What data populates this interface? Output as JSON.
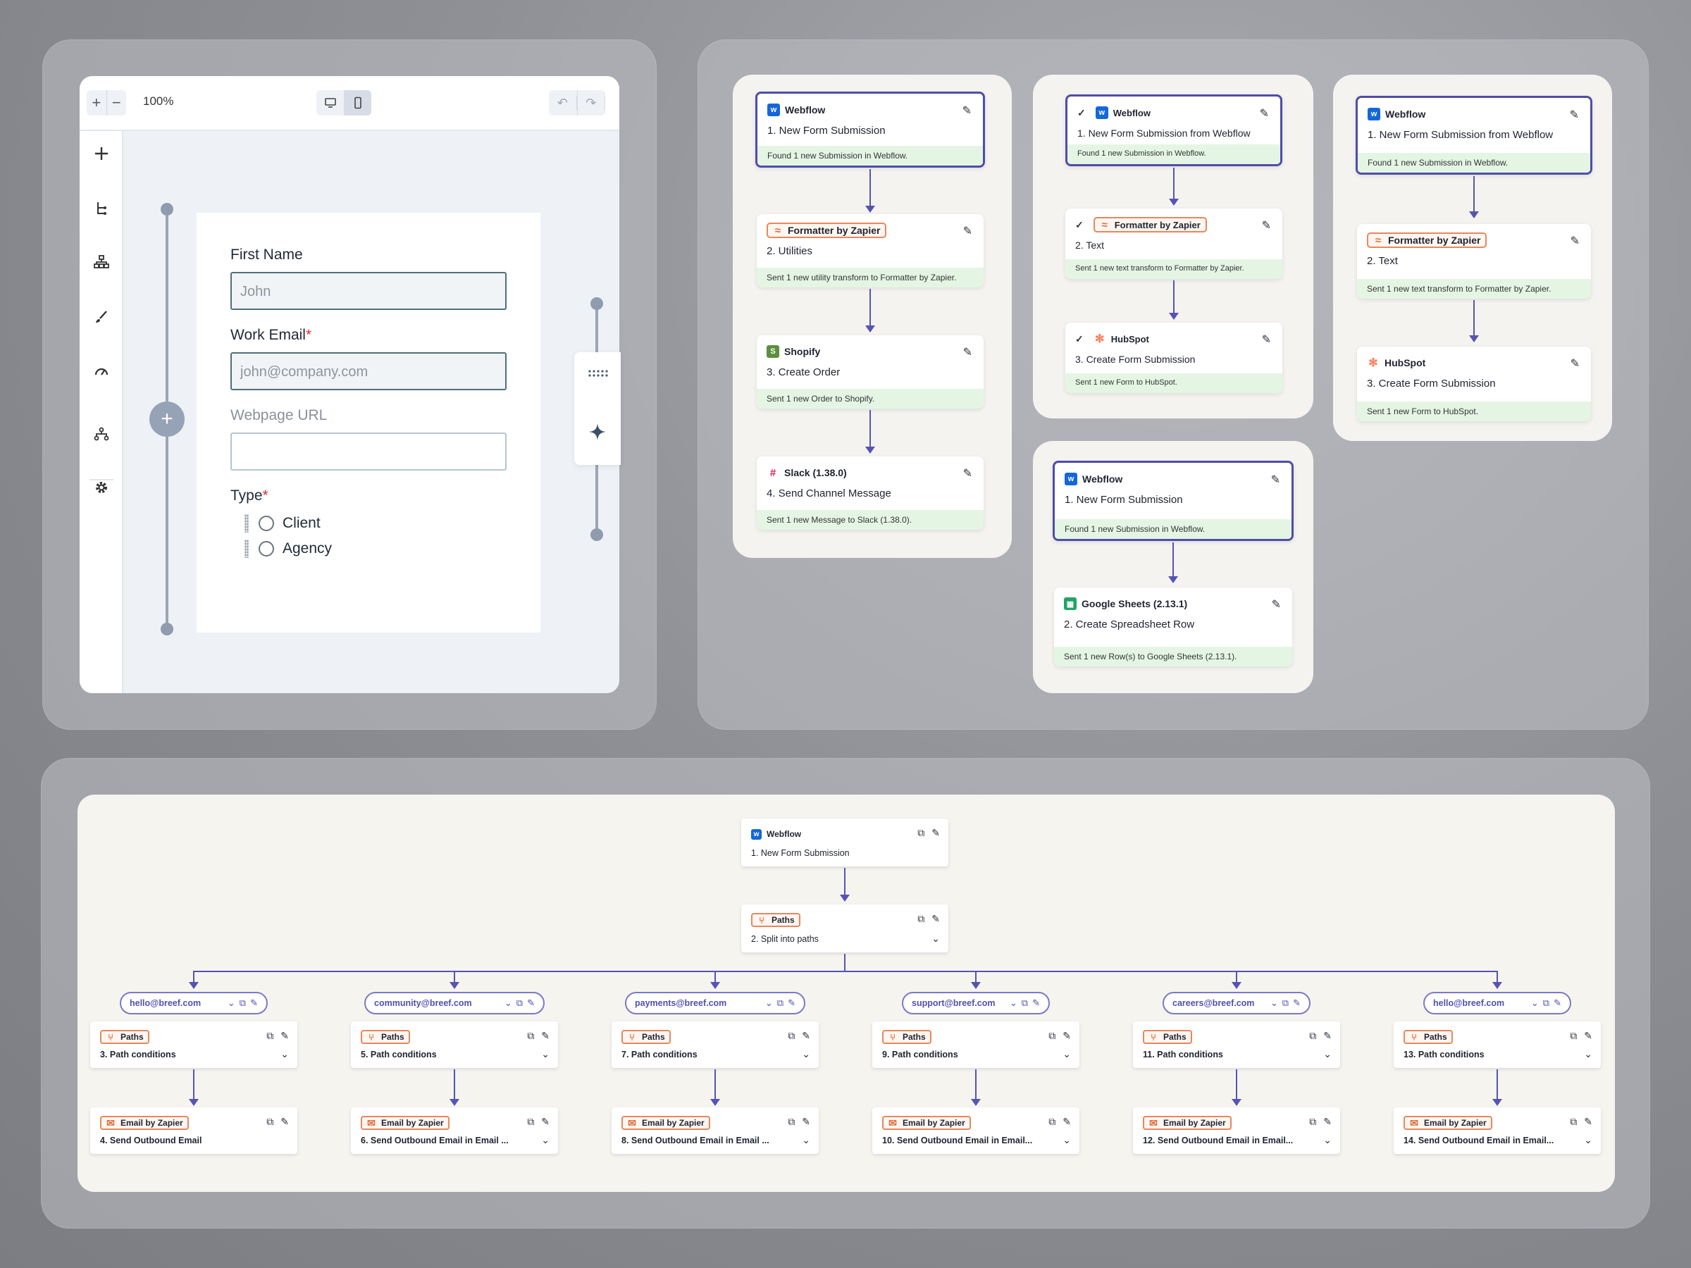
{
  "editor": {
    "zoom": "100%",
    "zoom_in": "+",
    "zoom_out": "−",
    "form": {
      "first_name_label": "First Name",
      "first_name_placeholder": "John",
      "work_email_label": "Work Email",
      "work_email_placeholder": "john@company.com",
      "required_mark": "*",
      "webpage_label": "Webpage URL",
      "type_label": "Type",
      "options": [
        "Client",
        "Agency"
      ]
    },
    "sidebar_icons": [
      "plus-icon",
      "tree-icon",
      "hierarchy-icon",
      "brush-icon",
      "gauge-icon",
      "network-icon",
      "settings-icon"
    ]
  },
  "zap1": [
    {
      "app": "Webflow",
      "step": "1. New Form Submission",
      "status": "Found 1 new Submission in Webflow."
    },
    {
      "app": "Formatter by Zapier",
      "step": "2. Utilities",
      "status": "Sent 1 new utility transform to Formatter by Zapier."
    },
    {
      "app": "Shopify",
      "step": "3. Create Order",
      "status": "Sent 1 new Order to Shopify."
    },
    {
      "app": "Slack (1.38.0)",
      "step": "4. Send Channel Message",
      "status": "Sent 1 new Message to Slack (1.38.0)."
    }
  ],
  "zap2": [
    {
      "app": "Webflow",
      "step": "1. New Form Submission from Webflow",
      "status": "Found 1 new Submission in Webflow."
    },
    {
      "app": "Formatter by Zapier",
      "step": "2. Text",
      "status": "Sent 1 new text transform to Formatter by Zapier."
    },
    {
      "app": "HubSpot",
      "step": "3. Create Form Submission",
      "status": "Sent 1 new Form to HubSpot."
    }
  ],
  "zap3": [
    {
      "app": "Webflow",
      "step": "1. New Form Submission from Webflow",
      "status": "Found 1 new Submission in Webflow."
    },
    {
      "app": "Formatter by Zapier",
      "step": "2. Text",
      "status": "Sent 1 new text transform to Formatter by Zapier."
    },
    {
      "app": "HubSpot",
      "step": "3. Create Form Submission",
      "status": "Sent 1 new Form to HubSpot."
    }
  ],
  "zap4": [
    {
      "app": "Webflow",
      "step": "1. New Form Submission",
      "status": "Found 1 new Submission in Webflow."
    },
    {
      "app": "Google Sheets (2.13.1)",
      "step": "2. Create Spreadsheet Row",
      "status": "Sent 1 new Row(s) to Google Sheets (2.13.1)."
    }
  ],
  "flow": {
    "trigger": {
      "app": "Webflow",
      "step": "1. New Form Submission"
    },
    "split": {
      "app": "Paths",
      "step": "2. Split into paths"
    },
    "branches": [
      {
        "email": "hello@breef.com",
        "cond_app": "Paths",
        "cond_step": "3. Path conditions",
        "act_app": "Email by Zapier",
        "act_step": "4. Send Outbound Email",
        "chev": false
      },
      {
        "email": "community@breef.com",
        "cond_app": "Paths",
        "cond_step": "5. Path conditions",
        "act_app": "Email by Zapier",
        "act_step": "6. Send Outbound Email in Email ...",
        "chev": true
      },
      {
        "email": "payments@breef.com",
        "cond_app": "Paths",
        "cond_step": "7. Path conditions",
        "act_app": "Email by Zapier",
        "act_step": "8. Send Outbound Email in Email ...",
        "chev": true
      },
      {
        "email": "support@breef.com",
        "cond_app": "Paths",
        "cond_step": "9. Path conditions",
        "act_app": "Email by Zapier",
        "act_step": "10. Send Outbound Email in Email...",
        "chev": true
      },
      {
        "email": "careers@breef.com",
        "cond_app": "Paths",
        "cond_step": "11. Path conditions",
        "act_app": "Email by Zapier",
        "act_step": "12. Send Outbound Email in Email...",
        "chev": true
      },
      {
        "email": "hello@breef.com",
        "cond_app": "Paths",
        "cond_step": "13. Path conditions",
        "act_app": "Email by Zapier",
        "act_step": "14. Send Outbound Email in Email...",
        "chev": true
      }
    ]
  }
}
